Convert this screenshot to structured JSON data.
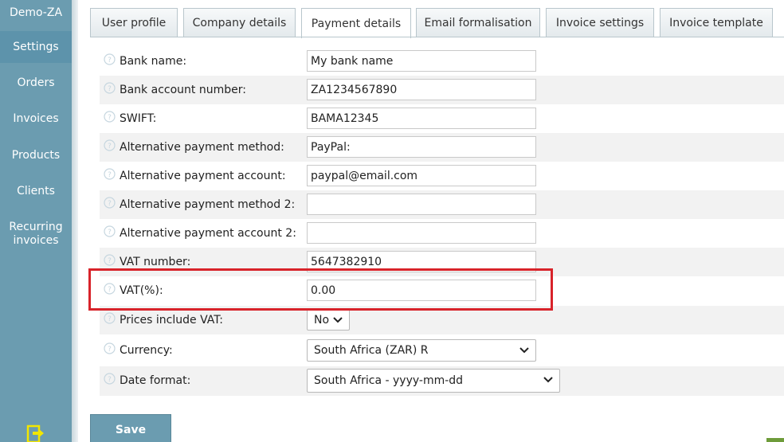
{
  "sidebar": {
    "brand": "Demo-ZA",
    "items": [
      {
        "label": "Settings"
      },
      {
        "label": "Orders"
      },
      {
        "label": "Invoices"
      },
      {
        "label": "Products"
      },
      {
        "label": "Clients"
      },
      {
        "label": "Recurring",
        "label2": "invoices"
      }
    ],
    "exit_icon": "exit-icon"
  },
  "tabs": [
    {
      "label": "User profile"
    },
    {
      "label": "Company details"
    },
    {
      "label": "Payment details"
    },
    {
      "label": "Email formalisation"
    },
    {
      "label": "Invoice settings"
    },
    {
      "label": "Invoice template"
    }
  ],
  "active_tab": "Payment details",
  "form": {
    "bank_name": {
      "label": "Bank name:",
      "value": "My bank name"
    },
    "bank_account": {
      "label": "Bank account number:",
      "value": "ZA1234567890"
    },
    "swift": {
      "label": "SWIFT:",
      "value": "BAMA12345"
    },
    "alt_method": {
      "label": "Alternative payment method:",
      "value": "PayPal:"
    },
    "alt_account": {
      "label": "Alternative payment account:",
      "value": "paypal@email.com"
    },
    "alt_method2": {
      "label": "Alternative payment method 2:",
      "value": ""
    },
    "alt_account2": {
      "label": "Alternative payment account 2:",
      "value": ""
    },
    "vat_number": {
      "label": "VAT number:",
      "value": "5647382910"
    },
    "vat_percent": {
      "label": "VAT(%):",
      "value": "0.00"
    },
    "prices_include_vat": {
      "label": "Prices include VAT:",
      "value": "No"
    },
    "currency": {
      "label": "Currency:",
      "value": "South Africa (ZAR) R"
    },
    "date_format": {
      "label": "Date format:",
      "value": "South Africa - yyyy-mm-dd"
    }
  },
  "save_label": "Save",
  "colors": {
    "sidebar": "#6b9cb0",
    "highlight": "#d8232a",
    "row_alt": "#f2f2f2"
  }
}
